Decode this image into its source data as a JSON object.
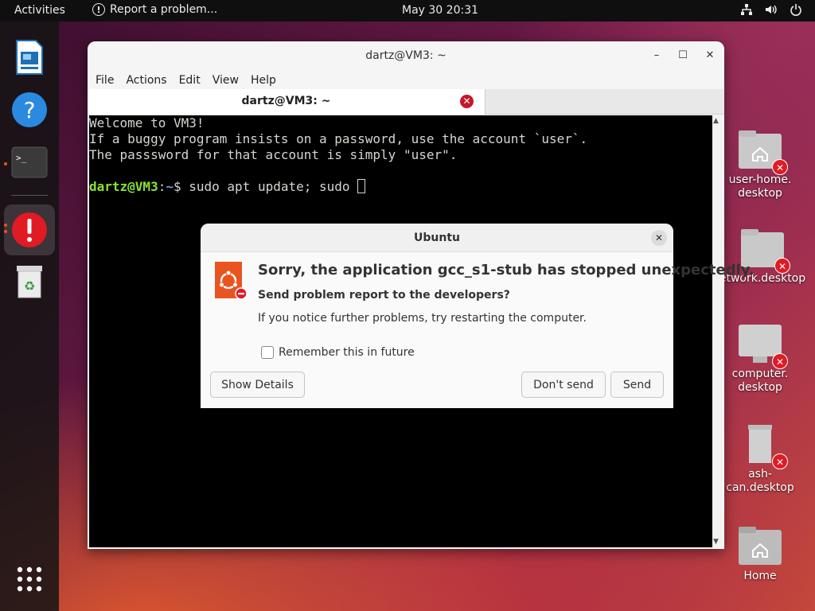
{
  "topbar": {
    "activities": "Activities",
    "report": "Report a problem...",
    "clock": "May 30  20:31",
    "tray_icons": [
      "network-icon",
      "volume-icon",
      "power-icon"
    ]
  },
  "dock": {
    "items": [
      "libreoffice-impress-icon",
      "help-icon",
      "terminal-icon",
      "error-reporter-icon",
      "trash-icon"
    ],
    "app_grid": "show-applications-icon"
  },
  "terminal": {
    "title": "dartz@VM3: ~",
    "menu": [
      "File",
      "Actions",
      "Edit",
      "View",
      "Help"
    ],
    "tab_title": "dartz@VM3: ~",
    "lines": [
      "Welcome to VM3!",
      "If a buggy program insists on a password, use the account `user`.",
      "The passsword for that account is simply \"user\"."
    ],
    "prompt_user": "dartz@VM3",
    "prompt_sep": ":",
    "prompt_path": "~",
    "prompt_dollar": "$ ",
    "command": "sudo apt update; sudo "
  },
  "dialog": {
    "title": "Ubuntu",
    "heading": "Sorry, the application gcc_s1-stub has stopped unexpectedly.",
    "subheading": "Send problem report to the developers?",
    "note": "If you notice further problems, try restarting the computer.",
    "remember": "Remember this in future",
    "show_details": "Show Details",
    "dont_send": "Don't send",
    "send": "Send"
  },
  "desktop": {
    "icons": [
      {
        "label": "user-home.\ndesktop"
      },
      {
        "label": "etwork.desktop"
      },
      {
        "label": "computer.\ndesktop"
      },
      {
        "label": "ash-can.desktop"
      },
      {
        "label": "Home"
      }
    ]
  },
  "colors": {
    "ubuntu_orange": "#e95420",
    "error_red": "#e01b24",
    "prompt_green": "#8ae234",
    "prompt_blue": "#729fcf"
  }
}
